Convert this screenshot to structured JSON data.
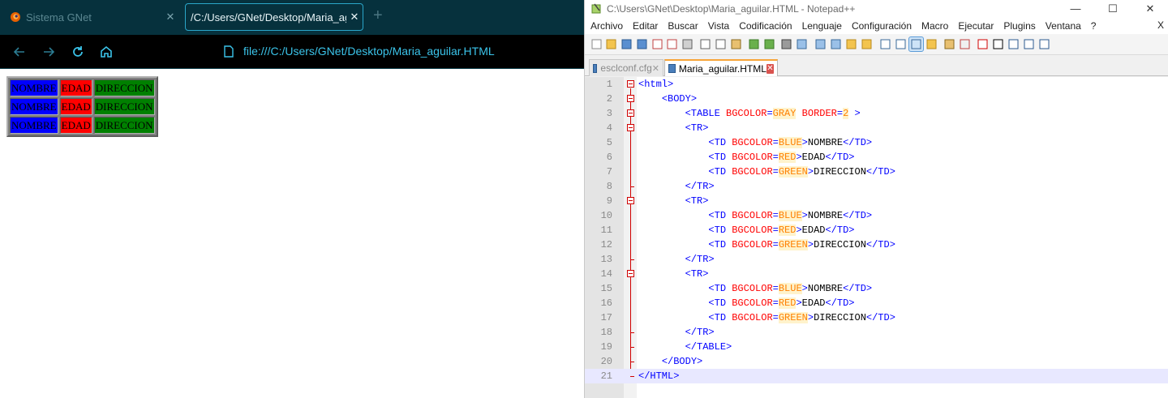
{
  "browser": {
    "tabs": [
      {
        "title": "Sistema GNet",
        "close": "✕"
      },
      {
        "title": "/C:/Users/GNet/Desktop/Maria_aguil",
        "close": "✕"
      }
    ],
    "new_tab": "+",
    "url": "file:///C:/Users/GNet/Desktop/Maria_aguilar.HTML",
    "table": [
      [
        "NOMBRE",
        "EDAD",
        "DIRECCION"
      ],
      [
        "NOMBRE",
        "EDAD",
        "DIRECCION"
      ],
      [
        "NOMBRE",
        "EDAD",
        "DIRECCION"
      ]
    ]
  },
  "notepad": {
    "title": "C:\\Users\\GNet\\Desktop\\Maria_aguilar.HTML - Notepad++",
    "menu": [
      "Archivo",
      "Editar",
      "Buscar",
      "Vista",
      "Codificación",
      "Lenguaje",
      "Configuración",
      "Macro",
      "Ejecutar",
      "Plugins",
      "Ventana",
      "?"
    ],
    "menu_close": "X",
    "doc_tabs": [
      {
        "name": "esclconf.cfg",
        "close": "✕"
      },
      {
        "name": "Maria_aguilar.HTML",
        "close": "✕"
      }
    ],
    "lines": [
      {
        "n": "1",
        "code": "<html>"
      },
      {
        "n": "2",
        "code": "    <BODY>"
      },
      {
        "n": "3",
        "code": "        <TABLE BGCOLOR=GRAY BORDER=2 >"
      },
      {
        "n": "4",
        "code": "        <TR>"
      },
      {
        "n": "5",
        "code": "            <TD BGCOLOR=BLUE>NOMBRE</TD>"
      },
      {
        "n": "6",
        "code": "            <TD BGCOLOR=RED>EDAD</TD>"
      },
      {
        "n": "7",
        "code": "            <TD BGCOLOR=GREEN>DIRECCION</TD>"
      },
      {
        "n": "8",
        "code": "        </TR>"
      },
      {
        "n": "9",
        "code": "        <TR>"
      },
      {
        "n": "10",
        "code": "            <TD BGCOLOR=BLUE>NOMBRE</TD>"
      },
      {
        "n": "11",
        "code": "            <TD BGCOLOR=RED>EDAD</TD>"
      },
      {
        "n": "12",
        "code": "            <TD BGCOLOR=GREEN>DIRECCION</TD>"
      },
      {
        "n": "13",
        "code": "        </TR>"
      },
      {
        "n": "14",
        "code": "        <TR>"
      },
      {
        "n": "15",
        "code": "            <TD BGCOLOR=BLUE>NOMBRE</TD>"
      },
      {
        "n": "16",
        "code": "            <TD BGCOLOR=RED>EDAD</TD>"
      },
      {
        "n": "17",
        "code": "            <TD BGCOLOR=GREEN>DIRECCION</TD>"
      },
      {
        "n": "18",
        "code": "        </TR>"
      },
      {
        "n": "19",
        "code": "        </TABLE>"
      },
      {
        "n": "20",
        "code": "    </BODY>"
      },
      {
        "n": "21",
        "code": "</HTML>"
      }
    ]
  },
  "colors": {
    "browser_tabbar": "#06313d",
    "browser_accent": "#3bc4ea",
    "cell_blue": "#0000ff",
    "cell_red": "#ff0000",
    "cell_green": "#008000",
    "table_gray": "#808080",
    "code_tag": "#0000ff",
    "code_attr": "#ff0000",
    "code_value": "#ff8000",
    "fold_marker": "#d00000"
  }
}
